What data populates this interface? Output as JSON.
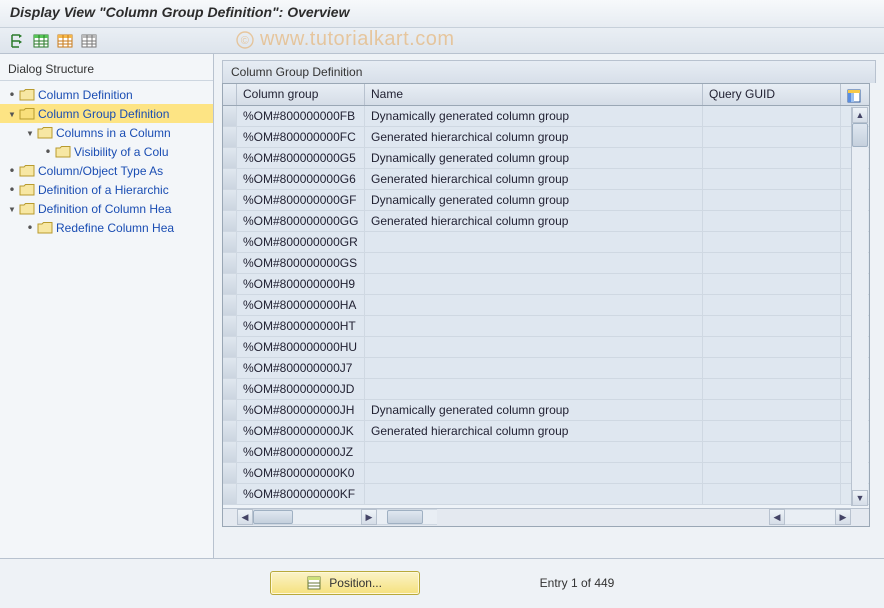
{
  "title": "Display View \"Column Group Definition\": Overview",
  "watermark": "www.tutorialkart.com",
  "sidebar": {
    "heading": "Dialog Structure",
    "items": [
      {
        "indent": 0,
        "expander": "•",
        "label": "Column Definition",
        "selected": false
      },
      {
        "indent": 0,
        "expander": "▾",
        "label": "Column Group Definition",
        "selected": true
      },
      {
        "indent": 1,
        "expander": "▾",
        "label": "Columns in a Column",
        "selected": false
      },
      {
        "indent": 2,
        "expander": "•",
        "label": "Visibility of a Colu",
        "selected": false
      },
      {
        "indent": 0,
        "expander": "•",
        "label": "Column/Object Type As",
        "selected": false
      },
      {
        "indent": 0,
        "expander": "•",
        "label": "Definition of a Hierarchic",
        "selected": false
      },
      {
        "indent": 0,
        "expander": "▾",
        "label": "Definition of Column Hea",
        "selected": false
      },
      {
        "indent": 1,
        "expander": "•",
        "label": "Redefine Column Hea",
        "selected": false
      }
    ]
  },
  "panel": {
    "title": "Column Group Definition",
    "columns": {
      "sel": "",
      "c1": "Column group",
      "c2": "Name",
      "c3": "Query GUID"
    },
    "rows": [
      {
        "c1": "%OM#800000000FB",
        "c2": "Dynamically generated column group",
        "c3": ""
      },
      {
        "c1": "%OM#800000000FC",
        "c2": "Generated hierarchical column group",
        "c3": ""
      },
      {
        "c1": "%OM#800000000G5",
        "c2": "Dynamically generated column group",
        "c3": ""
      },
      {
        "c1": "%OM#800000000G6",
        "c2": "Generated hierarchical column group",
        "c3": ""
      },
      {
        "c1": "%OM#800000000GF",
        "c2": "Dynamically generated column group",
        "c3": ""
      },
      {
        "c1": "%OM#800000000GG",
        "c2": "Generated hierarchical column group",
        "c3": ""
      },
      {
        "c1": "%OM#800000000GR",
        "c2": "",
        "c3": ""
      },
      {
        "c1": "%OM#800000000GS",
        "c2": "",
        "c3": ""
      },
      {
        "c1": "%OM#800000000H9",
        "c2": "",
        "c3": ""
      },
      {
        "c1": "%OM#800000000HA",
        "c2": "",
        "c3": ""
      },
      {
        "c1": "%OM#800000000HT",
        "c2": "",
        "c3": ""
      },
      {
        "c1": "%OM#800000000HU",
        "c2": "",
        "c3": ""
      },
      {
        "c1": "%OM#800000000J7",
        "c2": "",
        "c3": ""
      },
      {
        "c1": "%OM#800000000JD",
        "c2": "",
        "c3": ""
      },
      {
        "c1": "%OM#800000000JH",
        "c2": "Dynamically generated column group",
        "c3": ""
      },
      {
        "c1": "%OM#800000000JK",
        "c2": "Generated hierarchical column group",
        "c3": ""
      },
      {
        "c1": "%OM#800000000JZ",
        "c2": "",
        "c3": ""
      },
      {
        "c1": "%OM#800000000K0",
        "c2": "",
        "c3": ""
      },
      {
        "c1": "%OM#800000000KF",
        "c2": "",
        "c3": ""
      }
    ]
  },
  "footer": {
    "position_label": "Position...",
    "entry_text": "Entry 1 of 449"
  },
  "icons": {
    "toolbar": [
      "expand-all-icon",
      "table-green-icon",
      "table-orange-icon",
      "table-grey-icon"
    ]
  }
}
